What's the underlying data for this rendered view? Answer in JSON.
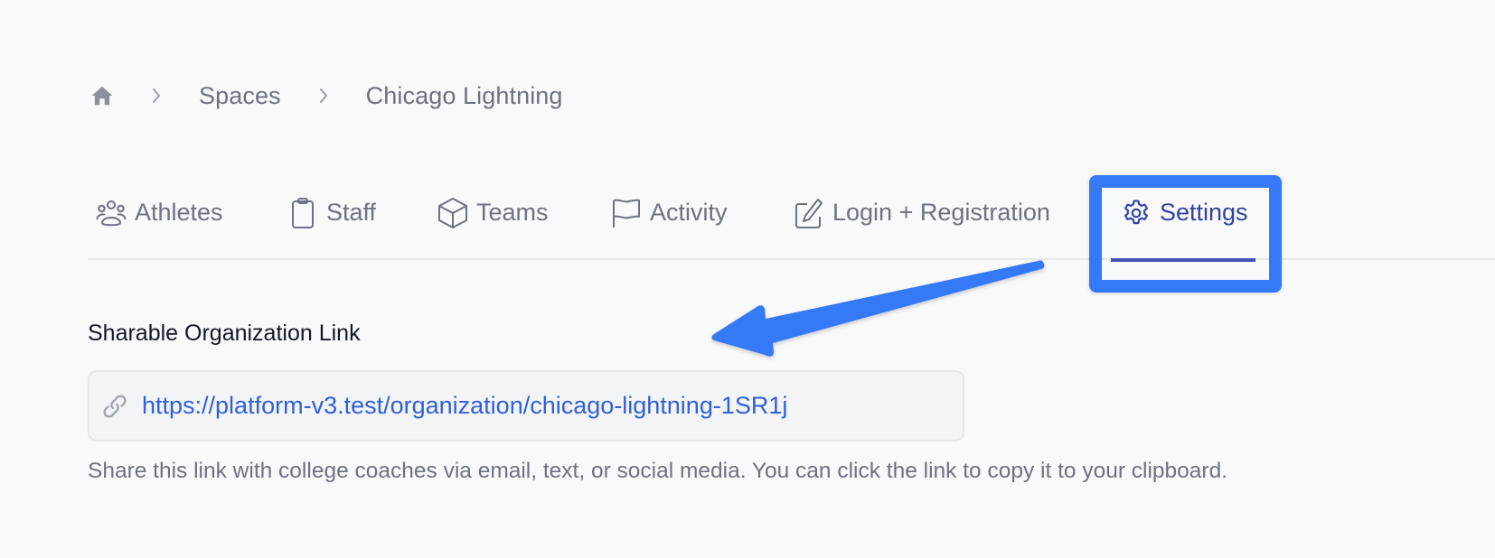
{
  "breadcrumb": {
    "home_icon": "home-icon",
    "separator_icon": "chevron-right-icon",
    "items": [
      {
        "label": "Spaces"
      },
      {
        "label": "Chicago Lightning"
      }
    ]
  },
  "tabs": [
    {
      "label": "Athletes",
      "icon": "users-icon",
      "active": false
    },
    {
      "label": "Staff",
      "icon": "clipboard-icon",
      "active": false
    },
    {
      "label": "Teams",
      "icon": "cube-icon",
      "active": false
    },
    {
      "label": "Activity",
      "icon": "flag-icon",
      "active": false
    },
    {
      "label": "Login + Registration",
      "icon": "pencil-square-icon",
      "active": false
    },
    {
      "label": "Settings",
      "icon": "gear-icon",
      "active": true
    }
  ],
  "annotation": {
    "highlight_color": "#3579f6",
    "arrow_color": "#3579f6"
  },
  "settings": {
    "section_title": "Sharable Organization Link",
    "link_icon": "link-icon",
    "link_url": "https://platform-v3.test/organization/chicago-lightning-1SR1j",
    "help_text": "Share this link with college coaches via email, text, or social media. You can click the link to copy it to your clipboard."
  },
  "colors": {
    "active_tab": "#3341a0",
    "link": "#2f5fdb",
    "muted_text": "#6b7280"
  }
}
